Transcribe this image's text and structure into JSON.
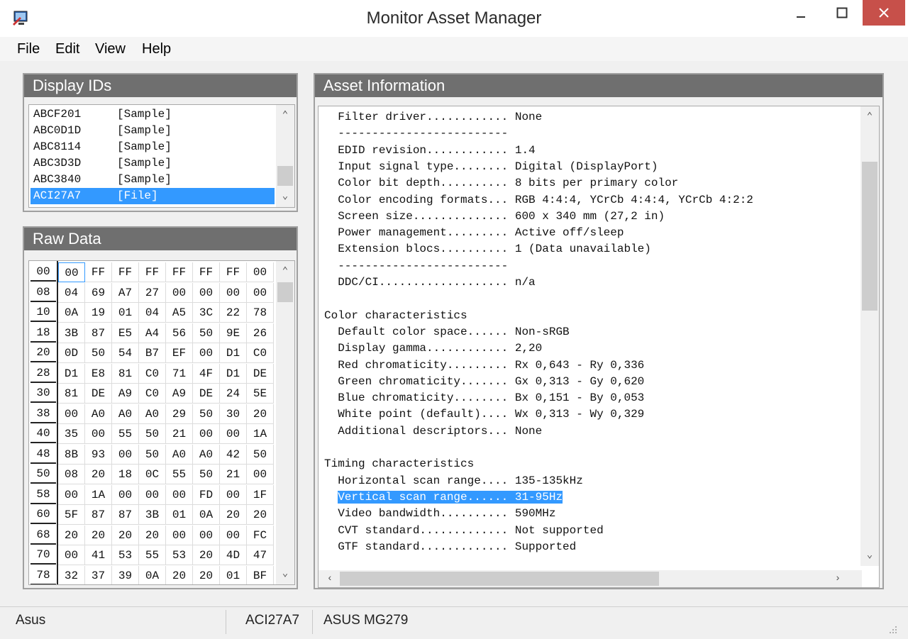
{
  "window": {
    "title": "Monitor Asset Manager"
  },
  "menu": [
    "File",
    "Edit",
    "View",
    "Help"
  ],
  "display_ids": {
    "title": "Display IDs",
    "items": [
      {
        "id": "ABCF201",
        "tag": "[Sample]"
      },
      {
        "id": "ABC0D1D",
        "tag": "[Sample]"
      },
      {
        "id": "ABC8114",
        "tag": "[Sample]"
      },
      {
        "id": "ABC3D3D",
        "tag": "[Sample]"
      },
      {
        "id": "ABC3840",
        "tag": "[Sample]"
      },
      {
        "id": "ACI27A7",
        "tag": "[File]"
      }
    ],
    "selected_index": 5
  },
  "raw_data": {
    "title": "Raw Data",
    "rows": [
      {
        "offset": "00",
        "bytes": [
          "00",
          "FF",
          "FF",
          "FF",
          "FF",
          "FF",
          "FF",
          "00"
        ]
      },
      {
        "offset": "08",
        "bytes": [
          "04",
          "69",
          "A7",
          "27",
          "00",
          "00",
          "00",
          "00"
        ]
      },
      {
        "offset": "10",
        "bytes": [
          "0A",
          "19",
          "01",
          "04",
          "A5",
          "3C",
          "22",
          "78"
        ]
      },
      {
        "offset": "18",
        "bytes": [
          "3B",
          "87",
          "E5",
          "A4",
          "56",
          "50",
          "9E",
          "26"
        ]
      },
      {
        "offset": "20",
        "bytes": [
          "0D",
          "50",
          "54",
          "B7",
          "EF",
          "00",
          "D1",
          "C0"
        ]
      },
      {
        "offset": "28",
        "bytes": [
          "D1",
          "E8",
          "81",
          "C0",
          "71",
          "4F",
          "D1",
          "DE"
        ]
      },
      {
        "offset": "30",
        "bytes": [
          "81",
          "DE",
          "A9",
          "C0",
          "A9",
          "DE",
          "24",
          "5E"
        ]
      },
      {
        "offset": "38",
        "bytes": [
          "00",
          "A0",
          "A0",
          "A0",
          "29",
          "50",
          "30",
          "20"
        ]
      },
      {
        "offset": "40",
        "bytes": [
          "35",
          "00",
          "55",
          "50",
          "21",
          "00",
          "00",
          "1A"
        ]
      },
      {
        "offset": "48",
        "bytes": [
          "8B",
          "93",
          "00",
          "50",
          "A0",
          "A0",
          "42",
          "50"
        ]
      },
      {
        "offset": "50",
        "bytes": [
          "08",
          "20",
          "18",
          "0C",
          "55",
          "50",
          "21",
          "00"
        ]
      },
      {
        "offset": "58",
        "bytes": [
          "00",
          "1A",
          "00",
          "00",
          "00",
          "FD",
          "00",
          "1F"
        ]
      },
      {
        "offset": "60",
        "bytes": [
          "5F",
          "87",
          "87",
          "3B",
          "01",
          "0A",
          "20",
          "20"
        ]
      },
      {
        "offset": "68",
        "bytes": [
          "20",
          "20",
          "20",
          "20",
          "00",
          "00",
          "00",
          "FC"
        ]
      },
      {
        "offset": "70",
        "bytes": [
          "00",
          "41",
          "53",
          "55",
          "53",
          "20",
          "4D",
          "47"
        ]
      },
      {
        "offset": "78",
        "bytes": [
          "32",
          "37",
          "39",
          "0A",
          "20",
          "20",
          "01",
          "BF"
        ]
      }
    ]
  },
  "asset_info": {
    "title": "Asset Information",
    "lines": [
      "  Filter driver............ None",
      "  -------------------------",
      "  EDID revision............ 1.4",
      "  Input signal type........ Digital (DisplayPort)",
      "  Color bit depth.......... 8 bits per primary color",
      "  Color encoding formats... RGB 4:4:4, YCrCb 4:4:4, YCrCb 4:2:2",
      "  Screen size.............. 600 x 340 mm (27,2 in)",
      "  Power management......... Active off/sleep",
      "  Extension blocs.......... 1 (Data unavailable)",
      "  -------------------------",
      "  DDC/CI................... n/a",
      "",
      "Color characteristics",
      "  Default color space...... Non-sRGB",
      "  Display gamma............ 2,20",
      "  Red chromaticity......... Rx 0,643 - Ry 0,336",
      "  Green chromaticity....... Gx 0,313 - Gy 0,620",
      "  Blue chromaticity........ Bx 0,151 - By 0,053",
      "  White point (default).... Wx 0,313 - Wy 0,329",
      "  Additional descriptors... None",
      "",
      "Timing characteristics",
      "  Horizontal scan range.... 135-135kHz",
      "  Vertical scan range...... 31-95Hz",
      "  Video bandwidth.......... 590MHz",
      "  CVT standard............. Not supported",
      "  GTF standard............. Supported"
    ],
    "highlighted_index": 23
  },
  "status": {
    "manufacturer": "Asus",
    "id": "ACI27A7",
    "model": "ASUS MG279"
  },
  "colors": {
    "selection": "#3399ff",
    "header": "#6f6f6f",
    "close": "#c7504a"
  }
}
